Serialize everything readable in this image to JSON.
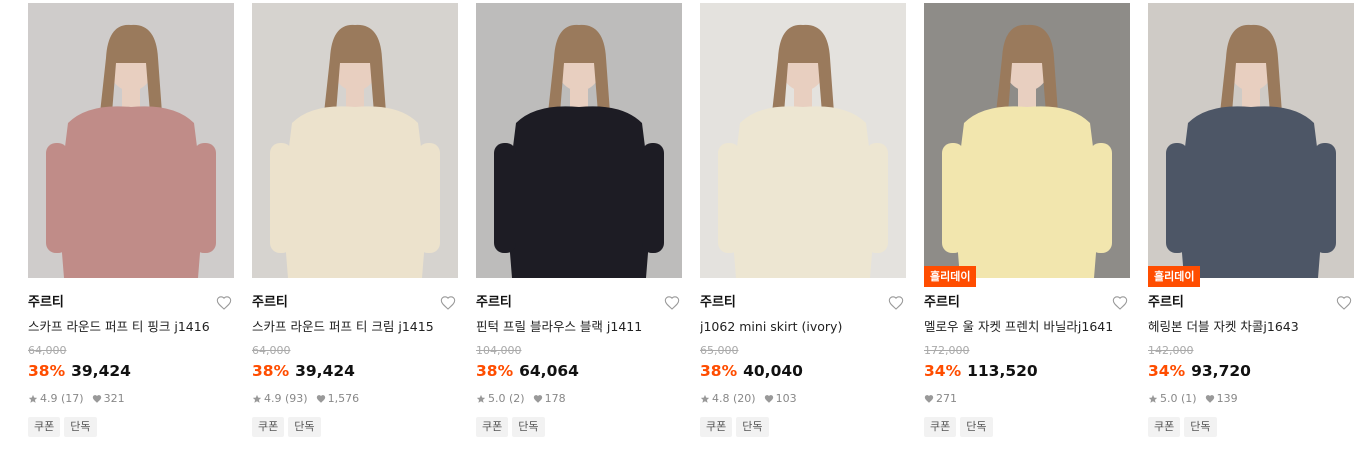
{
  "products": [
    {
      "brand": "주르티",
      "title": "스카프 라운드 퍼프 티 핑크 j1416",
      "original_price": "64,000",
      "discount": "38%",
      "price": "39,424",
      "rating": "4.9",
      "review_count": "(17)",
      "likes": "321",
      "badge": "",
      "tags": [
        "쿠폰",
        "단독"
      ],
      "bg_color": "#cfcccb",
      "garment_color": "#c08c88"
    },
    {
      "brand": "주르티",
      "title": "스카프 라운드 퍼프 티 크림 j1415",
      "original_price": "64,000",
      "discount": "38%",
      "price": "39,424",
      "rating": "4.9",
      "review_count": "(93)",
      "likes": "1,576",
      "badge": "",
      "tags": [
        "쿠폰",
        "단독"
      ],
      "bg_color": "#d6d3cf",
      "garment_color": "#ece2cc"
    },
    {
      "brand": "주르티",
      "title": "핀턱 프릴 블라우스 블랙 j1411",
      "original_price": "104,000",
      "discount": "38%",
      "price": "64,064",
      "rating": "5.0",
      "review_count": "(2)",
      "likes": "178",
      "badge": "",
      "tags": [
        "쿠폰",
        "단독"
      ],
      "bg_color": "#bdbcbb",
      "garment_color": "#1d1c24"
    },
    {
      "brand": "주르티",
      "title": "j1062 mini skirt (ivory)",
      "original_price": "65,000",
      "discount": "38%",
      "price": "40,040",
      "rating": "4.8",
      "review_count": "(20)",
      "likes": "103",
      "badge": "",
      "tags": [
        "쿠폰",
        "단독"
      ],
      "bg_color": "#e4e2de",
      "garment_color": "#ede6d2"
    },
    {
      "brand": "주르티",
      "title": "멜로우 울 자켓 프렌치 바닐라j1641",
      "original_price": "172,000",
      "discount": "34%",
      "price": "113,520",
      "rating": "",
      "review_count": "",
      "likes": "271",
      "badge": "홀리데이",
      "tags": [
        "쿠폰",
        "단독"
      ],
      "bg_color": "#8e8c88",
      "garment_color": "#f2e6ae"
    },
    {
      "brand": "주르티",
      "title": "헤링본 더블 자켓 차콜j1643",
      "original_price": "142,000",
      "discount": "34%",
      "price": "93,720",
      "rating": "5.0",
      "review_count": "(1)",
      "likes": "139",
      "badge": "홀리데이",
      "tags": [
        "쿠폰",
        "단독"
      ],
      "bg_color": "#cfcbc6",
      "garment_color": "#4d5666"
    }
  ],
  "colors": {
    "discount": "#ff4d00",
    "badge_bg": "#ff4d00",
    "original_price": "#aaaaaa",
    "tag_bg": "#f2f2f2"
  },
  "icons": {
    "wishlist": "heart-outline-icon",
    "rating": "star-icon",
    "likes": "heart-filled-icon"
  }
}
